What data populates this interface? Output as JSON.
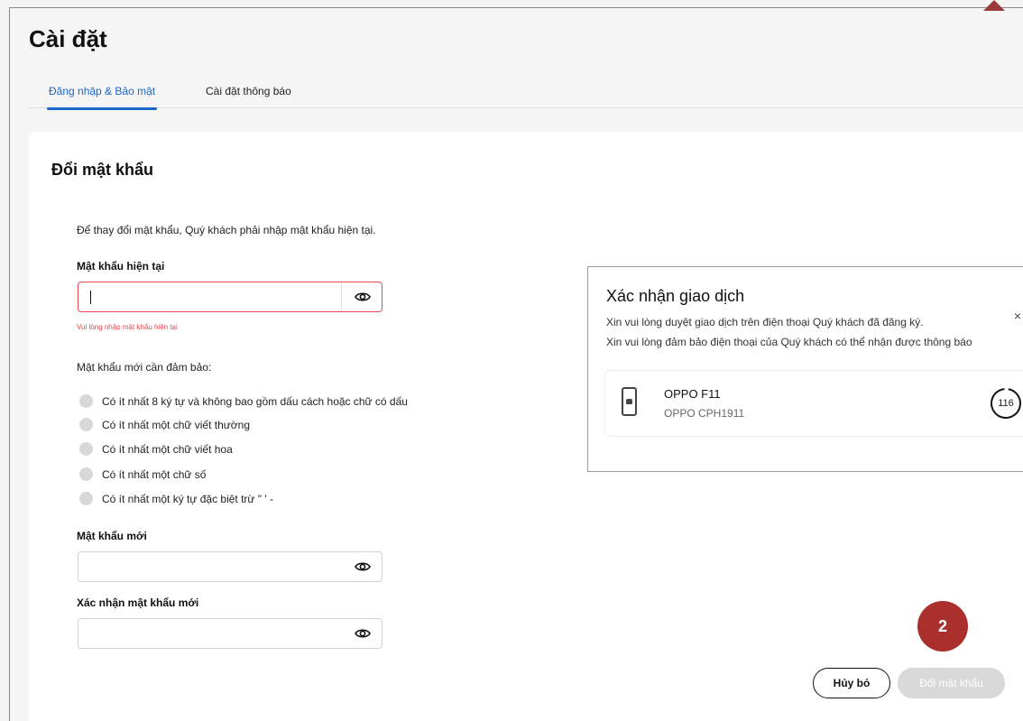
{
  "page": {
    "title": "Cài đặt"
  },
  "tabs": [
    {
      "label": "Đăng nhập & Bảo mật",
      "active": true
    },
    {
      "label": "Cài đặt thông báo",
      "active": false
    }
  ],
  "change_password": {
    "title": "Đổi mật khẩu",
    "intro": "Để thay đổi mật khẩu, Quý khách phải nhập mật khẩu hiện tại.",
    "current_label": "Mật khẩu hiện tại",
    "current_value": "",
    "current_error": "Vui lòng nhập mật khẩu hiện tại",
    "requirements_title": "Mật khẩu mới cần đảm bảo:",
    "requirements": [
      "Có ít nhất 8 ký tự và không bao gồm dấu cách hoặc chữ có dấu",
      "Có ít nhất một chữ viết thường",
      "Có ít nhất một chữ viết hoa",
      "Có ít nhất một chữ số",
      "Có ít nhất một ký tự đặc biệt trừ \" ' -"
    ],
    "new_label": "Mật khẩu mới",
    "new_value": "",
    "confirm_label": "Xác nhận mật khẩu mới",
    "confirm_value": ""
  },
  "confirm_dialog": {
    "title": "Xác nhận giao dịch",
    "line1": "Xin vui lòng duyệt giao dịch trên điện thoại Quý khách đã đăng ký.",
    "line2": "Xin vui lòng đảm bảo điện thoại của Quý khách có thể nhận được thông báo",
    "close_icon": "×",
    "device_name": "OPPO F11",
    "device_model": "OPPO CPH1911",
    "countdown": "116"
  },
  "step_badge": "2",
  "buttons": {
    "cancel": "Hủy bỏ",
    "submit": "Đổi mật khẩu"
  },
  "colors": {
    "accent": "#1a66c9",
    "error": "#e5484d",
    "badge": "#a9302c"
  }
}
